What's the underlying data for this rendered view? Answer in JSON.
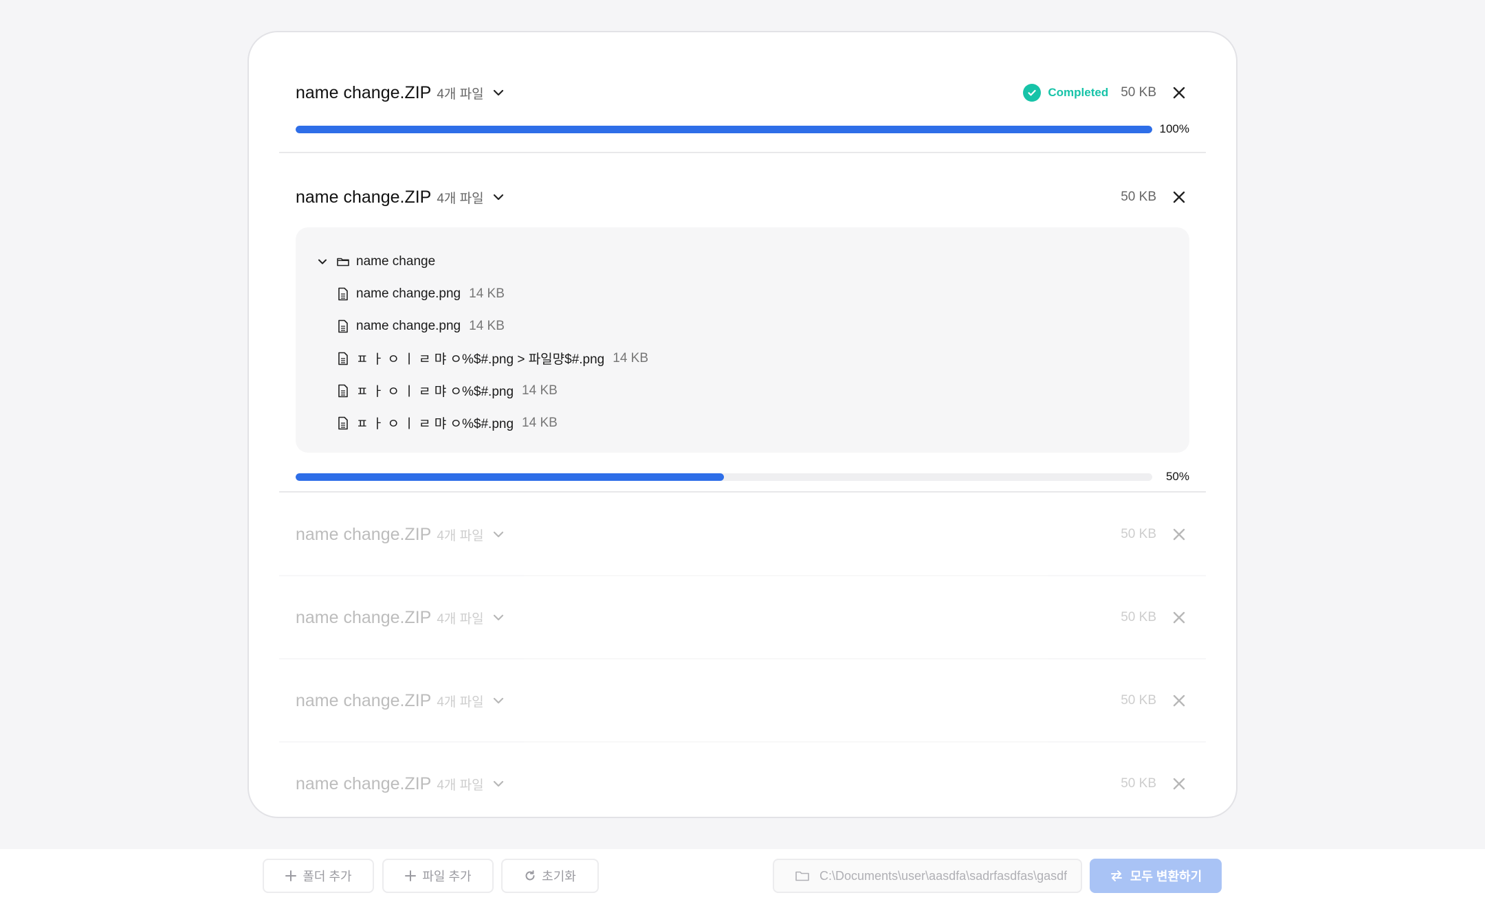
{
  "archives": [
    {
      "name": "name change.ZIP",
      "file_count": "4개 파일",
      "status": "Completed",
      "size": "50 KB",
      "progress_pct": 100,
      "progress_label": "100%"
    },
    {
      "name": "name change.ZIP",
      "file_count": "4개 파일",
      "size": "50 KB",
      "progress_pct": 50,
      "progress_label": "50%",
      "folder": "name change",
      "files": [
        {
          "name": "name change.png",
          "size": "14 KB"
        },
        {
          "name": "name change.png",
          "size": "14 KB"
        },
        {
          "name": "ㅍ ㅏ ㅇ ㅣ ㄹ 먀 ㅇ%$#.png > 파일먕$#.png",
          "size": "14 KB"
        },
        {
          "name": "ㅍ ㅏ ㅇ ㅣ ㄹ 먀 ㅇ%$#.png",
          "size": "14 KB"
        },
        {
          "name": "ㅍ ㅏ ㅇ ㅣ ㄹ 먀 ㅇ%$#.png",
          "size": "14 KB"
        }
      ]
    },
    {
      "name": "name change.ZIP",
      "file_count": "4개 파일",
      "size": "50 KB"
    },
    {
      "name": "name change.ZIP",
      "file_count": "4개 파일",
      "size": "50 KB"
    },
    {
      "name": "name change.ZIP",
      "file_count": "4개 파일",
      "size": "50 KB"
    },
    {
      "name": "name change.ZIP",
      "file_count": "4개 파일",
      "size": "50 KB"
    }
  ],
  "toolbar": {
    "add_folder": "폴더 추가",
    "add_file": "파일 추가",
    "reset": "초기화",
    "output_path": "C:\\Documents\\user\\aasdfa\\sadrfasdfas\\gasdf",
    "convert_all": "모두 변환하기"
  },
  "colors": {
    "accent": "#2e6ee8",
    "success": "#17c3a8",
    "primary_disabled": "#a9c3f5"
  },
  "icons": {
    "expand": "chevron-down-icon",
    "remove": "close-icon",
    "completed": "check-circle-icon",
    "folder": "folder-icon",
    "file": "file-icon",
    "add": "plus-icon",
    "reset": "refresh-icon",
    "convert": "swap-icon"
  }
}
